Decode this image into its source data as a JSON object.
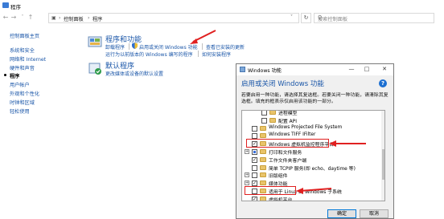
{
  "window": {
    "title": "程序"
  },
  "address": {
    "crumbs": [
      "控制面板",
      "程序"
    ],
    "search_placeholder": "搜索控制面板"
  },
  "sidebar": {
    "items": [
      "控制面板主页",
      "系统和安全",
      "网络和 Internet",
      "硬件和声音",
      "程序",
      "用户帐户",
      "外观和个性化",
      "时钟和区域",
      "轻松使用"
    ],
    "current_index": 4
  },
  "sections": {
    "programs_features": {
      "title": "程序和功能",
      "links": [
        "卸载程序",
        "启用或关闭 Windows 功能",
        "查看已安装的更新",
        "运行为以前版本的 Windows 编写的程序",
        "如何安装程序"
      ]
    },
    "default_programs": {
      "title": "默认程序",
      "links": [
        "更改媒体或设备的默认设置"
      ]
    }
  },
  "dialog": {
    "title": "Windows 功能",
    "heading": "启用或关闭 Windows 功能",
    "help_glyph": "?",
    "description": "若要启用一种功能，请选择其复选框。若要关闭一种功能，请清除其复选框。填充的框表示仅启用该功能的一部分。",
    "controls": {
      "minimize": "—",
      "maximize": "□",
      "close": "✕"
    },
    "features": [
      {
        "label": "进程模型",
        "state": "unchecked",
        "indent": 2,
        "expander": ""
      },
      {
        "label": "配置 API",
        "state": "unchecked",
        "indent": 2,
        "expander": ""
      },
      {
        "label": "Windows Projected File System",
        "state": "unchecked",
        "indent": 0,
        "expander": ""
      },
      {
        "label": "Windows TIFF IFilter",
        "state": "unchecked",
        "indent": 0,
        "expander": ""
      },
      {
        "label": "Windows 虚拟机监控程序平台",
        "state": "checked",
        "indent": 0,
        "expander": ""
      },
      {
        "label": "打印和文件服务",
        "state": "partial",
        "indent": 0,
        "expander": "+"
      },
      {
        "label": "工作文件夹客户端",
        "state": "checked",
        "indent": 0,
        "expander": ""
      },
      {
        "label": "简单 TCPIP 服务(即 echo、daytime 等)",
        "state": "unchecked",
        "indent": 0,
        "expander": ""
      },
      {
        "label": "旧版组件",
        "state": "unchecked",
        "indent": 0,
        "expander": "+"
      },
      {
        "label": "媒体功能",
        "state": "checked",
        "indent": 0,
        "expander": "+"
      },
      {
        "label": "适用于 Linux 的 Windows 子系统",
        "state": "unchecked",
        "indent": 0,
        "expander": ""
      },
      {
        "label": "虚拟机平台",
        "state": "checked",
        "indent": 0,
        "expander": ""
      },
      {
        "label": "远程差分压缩 API 支持",
        "state": "checked",
        "indent": 0,
        "expander": ""
      }
    ],
    "ok_label": "确定",
    "cancel_label": "取消"
  },
  "colors": {
    "link": "#1a56a8",
    "highlight": "#e02020",
    "selection": "#3a6fd8"
  }
}
